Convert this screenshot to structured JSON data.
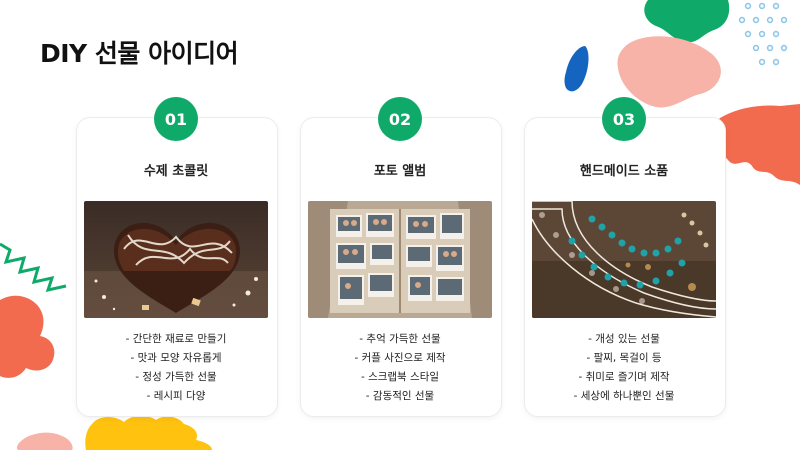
{
  "title": "DIY 선물 아이디어",
  "colors": {
    "accent_green": "#0fa96a",
    "coral": "#f26b4f",
    "pink": "#f8b3a8",
    "yellow": "#ffc20e",
    "blue": "#1565c0",
    "light_blue": "#8fc7e8"
  },
  "cards": [
    {
      "number": "01",
      "title": "수제 초콜릿",
      "image": "heart-chocolate-cake-photo",
      "bullets": [
        "- 간단한 재료로 만들기",
        "- 맛과 모양 자유롭게",
        "- 정성 가득한 선물",
        "- 레시피 다양"
      ]
    },
    {
      "number": "02",
      "title": "포토 앨범",
      "image": "couple-photo-album-photo",
      "bullets": [
        "- 추억 가득한 선물",
        "- 커플 사진으로 제작",
        "- 스크랩북 스타일",
        "- 감동적인 선물"
      ]
    },
    {
      "number": "03",
      "title": "핸드메이드 소품",
      "image": "beaded-necklace-lace-photo",
      "bullets": [
        "- 개성 있는 선물",
        "- 팔찌, 목걸이 등",
        "- 취미로 즐기며 제작",
        "- 세상에 하나뿐인 선물"
      ]
    }
  ]
}
